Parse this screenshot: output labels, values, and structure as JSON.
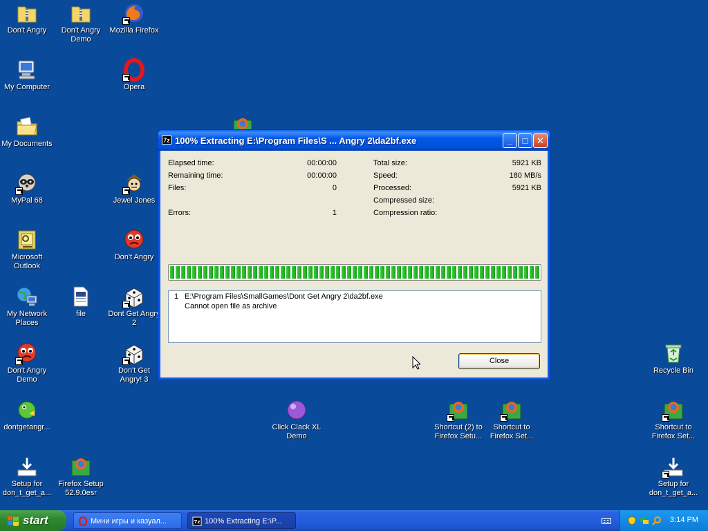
{
  "desktop": {
    "icons": [
      {
        "label": "Don't Angry"
      },
      {
        "label": "Don't Angry Demo"
      },
      {
        "label": "Mozilla Firefox"
      },
      {
        "label": "My Computer"
      },
      {
        "label": "Opera"
      },
      {
        "label": "My Documents"
      },
      {
        "label": "MyPal 68"
      },
      {
        "label": "Jewel Jones"
      },
      {
        "label": "Microsoft Outlook"
      },
      {
        "label": "Don't Angry"
      },
      {
        "label": "My Network Places"
      },
      {
        "label": "file"
      },
      {
        "label": "Dont Get Angry 2"
      },
      {
        "label": "Don't Angry Demo"
      },
      {
        "label": "Don't Get Angry! 3"
      },
      {
        "label": "dontgetangr..."
      },
      {
        "label": "Click Clack XL Demo"
      },
      {
        "label": "Shortcut (2) to Firefox Setu..."
      },
      {
        "label": "Shortcut to Firefox Set..."
      },
      {
        "label": "Shortcut to Firefox Set..."
      },
      {
        "label": "Recycle Bin"
      },
      {
        "label": "Setup for don_t_get_a..."
      },
      {
        "label": "Firefox Setup 52.9.0esr"
      },
      {
        "label": "Setup for don_t_get_a..."
      }
    ]
  },
  "dialog": {
    "title": "100% Extracting E:\\Program Files\\S ... Angry 2\\da2bf.exe",
    "app_icon": "7z",
    "stats_left": [
      {
        "label": "Elapsed time:",
        "value": "00:00:00"
      },
      {
        "label": "Remaining time:",
        "value": "00:00:00"
      },
      {
        "label": "Files:",
        "value": "0"
      },
      {
        "label": "Errors:",
        "value": "1"
      }
    ],
    "stats_right": [
      {
        "label": "Total size:",
        "value": "5921 KB"
      },
      {
        "label": "Speed:",
        "value": "180 MB/s"
      },
      {
        "label": "Processed:",
        "value": "5921 KB"
      },
      {
        "label": "Compressed size:",
        "value": ""
      },
      {
        "label": "Compression ratio:",
        "value": ""
      }
    ],
    "progress_percent": 100,
    "messages": {
      "index": "1",
      "path": "E:\\Program Files\\SmallGames\\Dont Get Angry 2\\da2bf.exe",
      "error": "Cannot open file as archive"
    },
    "close_label": "Close"
  },
  "taskbar": {
    "start_label": "start",
    "tasks": [
      {
        "label": "Мини игры и казуал..."
      },
      {
        "label": "100% Extracting E:\\P..."
      }
    ],
    "clock": "3:14 PM"
  },
  "colors": {
    "desktop": "#0a4a9a",
    "titlebar": "#0058e8",
    "progress": "#21a721",
    "start": "#2f8a2f"
  }
}
